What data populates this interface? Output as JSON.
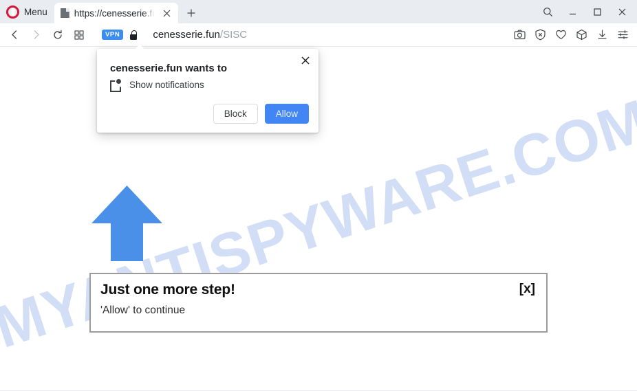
{
  "browser": {
    "menu_label": "Menu",
    "logo_icon": "opera-logo-icon",
    "tab": {
      "title": "https://cenesserie.fun",
      "favicon": "page-icon",
      "close_icon": "✕"
    },
    "new_tab_icon": "+",
    "window_controls": {
      "search_icon": "search-icon",
      "minimize_icon": "minimize-icon",
      "maximize_icon": "maximize-icon",
      "close_icon": "close-icon"
    },
    "toolbar": {
      "back_icon": "back-arrow-icon",
      "forward_icon": "forward-arrow-icon",
      "reload_icon": "reload-icon",
      "speeddial_icon": "grid-icon",
      "vpn_badge": "VPN",
      "lock_icon": "lock-icon",
      "url_domain": "cenesserie.fun",
      "url_path": "/SISC",
      "tools": [
        {
          "name": "snapshot-icon",
          "label": "camera"
        },
        {
          "name": "adblock-icon",
          "label": "shield-x"
        },
        {
          "name": "favorite-icon",
          "label": "heart"
        },
        {
          "name": "extensions-icon",
          "label": "cube"
        },
        {
          "name": "downloads-icon",
          "label": "download"
        },
        {
          "name": "easy-setup-icon",
          "label": "sliders"
        }
      ]
    }
  },
  "permission_dialog": {
    "title": "cenesserie.fun wants to",
    "permission_label": "Show notifications",
    "permission_icon": "notification-icon",
    "close_icon": "✕",
    "block_label": "Block",
    "allow_label": "Allow",
    "allow_color": "#4285f4"
  },
  "page": {
    "watermark": "MYANTISPYWARE.COM",
    "watermark_color": "#d2def6",
    "arrow": {
      "name": "blue-up-arrow",
      "color": "#4a90e8"
    },
    "content_box": {
      "title": "Just one more step!",
      "subtitle": "'Allow' to continue",
      "close_label": "[x]"
    }
  }
}
